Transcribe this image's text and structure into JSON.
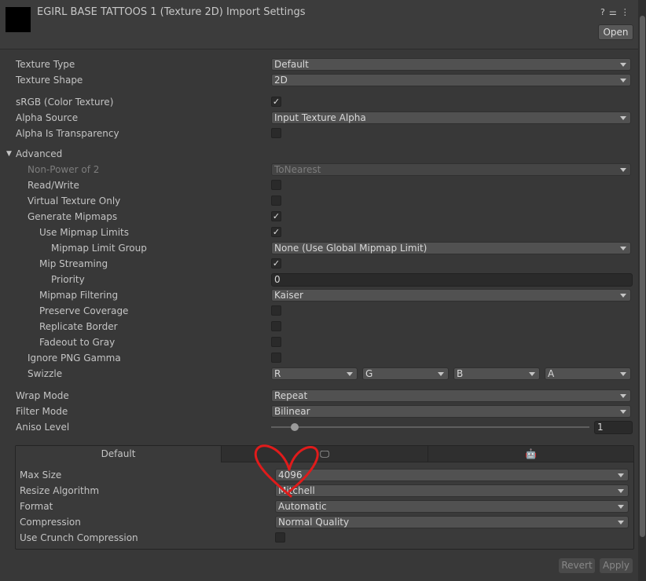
{
  "header": {
    "title": "EGIRL BASE TATTOOS 1 (Texture 2D) Import Settings",
    "open_label": "Open",
    "icons": [
      "help-icon",
      "presets-icon",
      "more-icon"
    ]
  },
  "fields": {
    "texture_type": {
      "label": "Texture Type",
      "value": "Default"
    },
    "texture_shape": {
      "label": "Texture Shape",
      "value": "2D"
    },
    "srgb": {
      "label": "sRGB (Color Texture)",
      "checked": true
    },
    "alpha_source": {
      "label": "Alpha Source",
      "value": "Input Texture Alpha"
    },
    "alpha_transparency": {
      "label": "Alpha Is Transparency",
      "checked": false
    },
    "advanced": {
      "label": "Advanced",
      "expanded": true
    },
    "npot": {
      "label": "Non-Power of 2",
      "value": "ToNearest"
    },
    "read_write": {
      "label": "Read/Write",
      "checked": false
    },
    "virtual_texture": {
      "label": "Virtual Texture Only",
      "checked": false
    },
    "gen_mipmaps": {
      "label": "Generate Mipmaps",
      "checked": true
    },
    "mip_limits": {
      "label": "Use Mipmap Limits",
      "checked": true
    },
    "mip_limit_group": {
      "label": "Mipmap Limit Group",
      "value": "None (Use Global Mipmap Limit)"
    },
    "mip_streaming": {
      "label": "Mip Streaming",
      "checked": true
    },
    "priority": {
      "label": "Priority",
      "value": "0"
    },
    "mip_filtering": {
      "label": "Mipmap Filtering",
      "value": "Kaiser"
    },
    "preserve_coverage": {
      "label": "Preserve Coverage",
      "checked": false
    },
    "replicate_border": {
      "label": "Replicate Border",
      "checked": false
    },
    "fadeout": {
      "label": "Fadeout to Gray",
      "checked": false
    },
    "ignore_png_gamma": {
      "label": "Ignore PNG Gamma",
      "checked": false
    },
    "swizzle": {
      "label": "Swizzle",
      "values": [
        "R",
        "G",
        "B",
        "A"
      ]
    },
    "wrap_mode": {
      "label": "Wrap Mode",
      "value": "Repeat"
    },
    "filter_mode": {
      "label": "Filter Mode",
      "value": "Bilinear"
    },
    "aniso": {
      "label": "Aniso Level",
      "value": "1"
    }
  },
  "platform": {
    "tabs": [
      "Default",
      "monitor-icon",
      "android-icon"
    ],
    "max_size": {
      "label": "Max Size",
      "value": "4096"
    },
    "resize": {
      "label": "Resize Algorithm",
      "value": "Mitchell"
    },
    "format": {
      "label": "Format",
      "value": "Automatic"
    },
    "compression": {
      "label": "Compression",
      "value": "Normal Quality"
    },
    "crunch": {
      "label": "Use Crunch Compression",
      "checked": false
    }
  },
  "footer": {
    "revert": "Revert",
    "apply": "Apply"
  },
  "annotation": {
    "color": "#e01b1b",
    "shape": "heart"
  }
}
